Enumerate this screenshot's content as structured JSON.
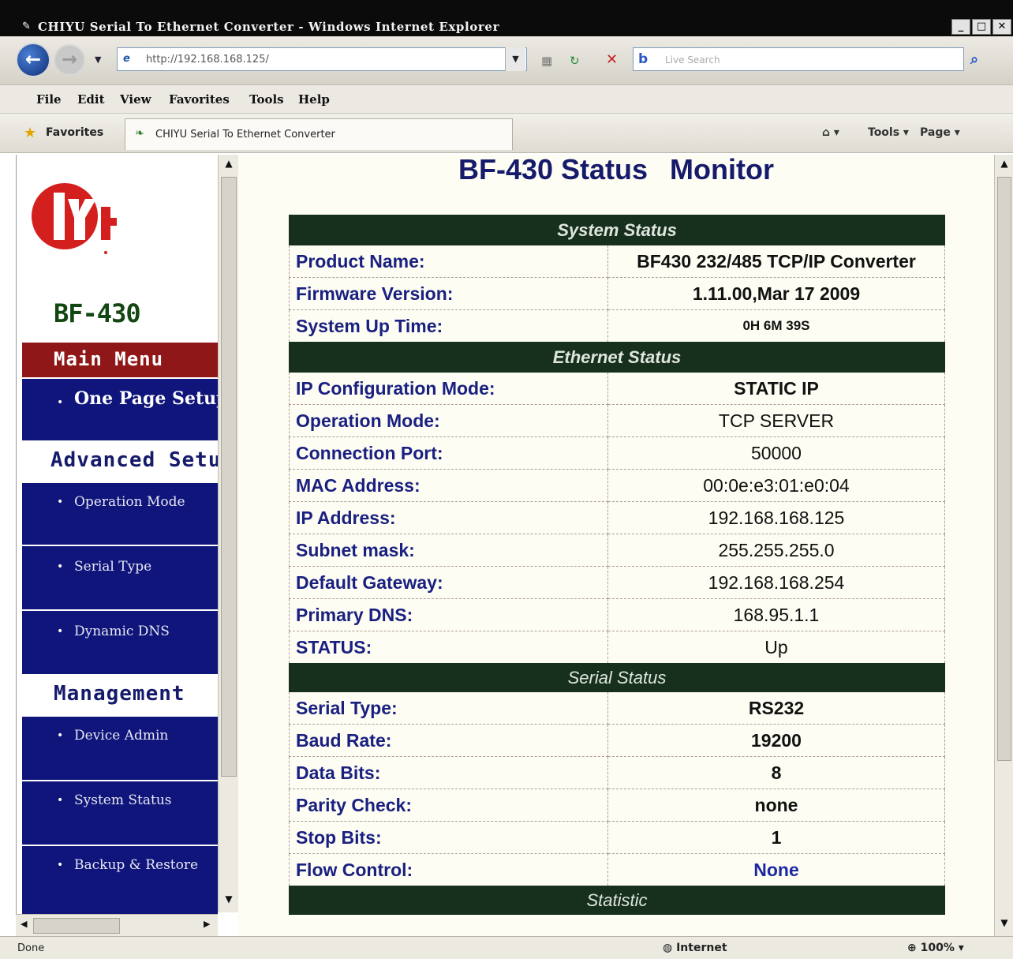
{
  "window": {
    "title": "CHIYU Serial To Ethernet Converter - Windows Internet Explorer",
    "controls": [
      "_",
      "□",
      "✕"
    ]
  },
  "browser": {
    "address": "http://192.168.168.125/",
    "search_placeholder": "Live Search",
    "menu": [
      "File",
      "Edit",
      "View",
      "Favorites",
      "Tools",
      "Help"
    ],
    "favorites_label": "Favorites",
    "tab_title": "CHIYU Serial To Ethernet Converter",
    "commands": [
      "Page ▾",
      "Tools ▾"
    ],
    "status_left": "Done",
    "status_zone": "Internet",
    "status_zoom": "100%"
  },
  "sidebar": {
    "model": "BF-430",
    "main_menu": "Main Menu",
    "one_page": "One Page Setup",
    "advanced_heading": "Advanced Setup",
    "advanced_items": [
      "Operation Mode",
      "Serial Type",
      "Dynamic DNS"
    ],
    "management_heading": "Management",
    "management_items": [
      "Device Admin",
      "System Status",
      "Backup & Restore"
    ]
  },
  "page": {
    "title_part1": "BF-430 Status",
    "title_part2": "Monitor"
  },
  "system_status": {
    "heading": "System Status",
    "rows": [
      {
        "label": "Product Name:",
        "value": "BF430 232/485 TCP/IP Converter"
      },
      {
        "label": "Firmware Version:",
        "value": "1.11.00,Mar 17 2009"
      },
      {
        "label": "System Up Time:",
        "value": "0H 6M 39S"
      }
    ]
  },
  "ethernet_status": {
    "heading": "Ethernet Status",
    "rows": [
      {
        "label": "IP Configuration Mode:",
        "value": "STATIC IP"
      },
      {
        "label": "Operation Mode:",
        "value": "TCP SERVER"
      },
      {
        "label": "Connection Port:",
        "value": "50000"
      },
      {
        "label": "MAC Address:",
        "value": "00:0e:e3:01:e0:04"
      },
      {
        "label": "IP Address:",
        "value": "192.168.168.125"
      },
      {
        "label": "Subnet mask:",
        "value": "255.255.255.0"
      },
      {
        "label": "Default Gateway:",
        "value": "192.168.168.254"
      },
      {
        "label": "Primary DNS:",
        "value": "168.95.1.1"
      },
      {
        "label": "STATUS:",
        "value": "Up"
      }
    ]
  },
  "serial_status": {
    "heading": "Serial Status",
    "rows": [
      {
        "label": "Serial Type:",
        "value": "RS232"
      },
      {
        "label": "Baud Rate:",
        "value": "19200"
      },
      {
        "label": "Data Bits:",
        "value": "8"
      },
      {
        "label": "Parity Check:",
        "value": "none"
      },
      {
        "label": "Stop Bits:",
        "value": "1"
      },
      {
        "label": "Flow Control:",
        "value": "None"
      }
    ]
  },
  "statistic": {
    "heading": "Statistic"
  },
  "colors": {
    "section_bar": "#17301d",
    "nav_blue": "#0f157a",
    "main_menu_red": "#8f1717",
    "page_bg": "#fdfdf3",
    "logo_red": "#d41f1f"
  }
}
